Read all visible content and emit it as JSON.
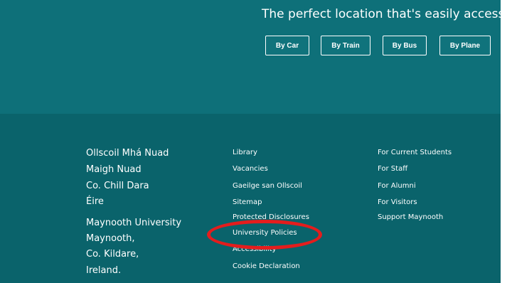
{
  "hero": {
    "headline": "The perfect location that's easily accessible",
    "buttons": [
      "By Car",
      "By Train",
      "By Bus",
      "By Plane"
    ]
  },
  "address": {
    "irish": [
      "Ollscoil Mhá Nuad",
      "Maigh Nuad",
      "Co. Chill Dara",
      "Éire"
    ],
    "english": [
      "Maynooth University",
      "Maynooth,",
      "Co. Kildare,",
      "Ireland."
    ]
  },
  "links_middle": [
    "Library",
    "Vacancies",
    "Gaeilge san Ollscoil",
    "Sitemap",
    "Protected Disclosures",
    "University Policies",
    "Accessibility",
    "Cookie Declaration"
  ],
  "links_right": [
    "For Current Students",
    "For Staff",
    "For Alumni",
    "For Visitors",
    "Support Maynooth"
  ],
  "colors": {
    "teal": "#0e7079",
    "footer_teal": "#0a636b",
    "annotation_red": "#e41d1d"
  }
}
